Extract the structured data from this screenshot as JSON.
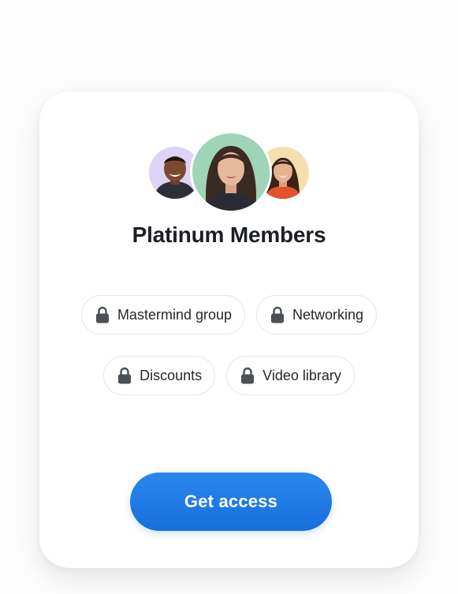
{
  "card": {
    "title": "Platinum Members",
    "avatars": [
      {
        "name": "member-avatar-left",
        "bg": "#ddd3f6"
      },
      {
        "name": "member-avatar-center",
        "bg": "#9fd4b6"
      },
      {
        "name": "member-avatar-right",
        "bg": "#f6dfae"
      }
    ],
    "features": [
      {
        "label": "Mastermind group",
        "icon": "lock-icon"
      },
      {
        "label": "Networking",
        "icon": "lock-icon"
      },
      {
        "label": "Discounts",
        "icon": "lock-icon"
      },
      {
        "label": "Video library",
        "icon": "lock-icon"
      }
    ],
    "cta_label": "Get access"
  },
  "colors": {
    "accent": "#1f7be6",
    "title_text": "#1c1f24",
    "chip_border": "#e3e5e8",
    "lock_icon": "#4b4f56"
  }
}
